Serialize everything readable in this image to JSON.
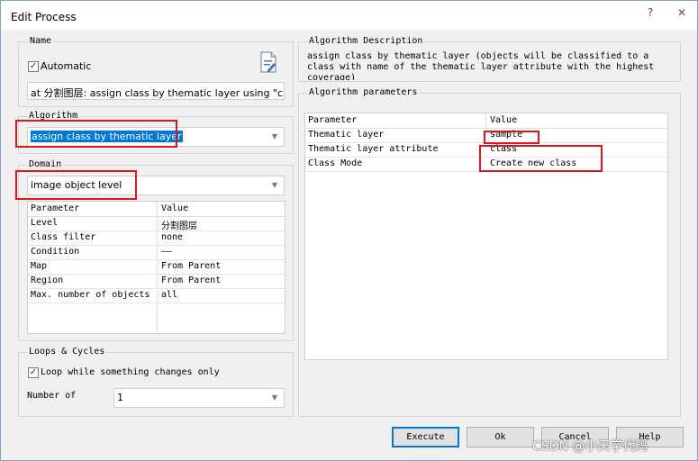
{
  "window": {
    "title": "Edit Process",
    "help_label": "?",
    "close_label": "✕"
  },
  "name_group": {
    "legend": "Name",
    "automatic_label": "Automatic",
    "automatic_checked": true,
    "name_value": "at  分割图层: assign class by thematic layer using \"class\""
  },
  "algorithm_group": {
    "legend": "Algorithm",
    "selected": "assign class by thematic layer"
  },
  "domain_group": {
    "legend": "Domain",
    "selected": "image object level",
    "table": {
      "headers": [
        "Parameter",
        "Value"
      ],
      "rows": [
        [
          "Level",
          "分割图层"
        ],
        [
          "Class filter",
          "none"
        ],
        [
          "Condition",
          "——"
        ],
        [
          "Map",
          "From Parent"
        ],
        [
          "Region",
          "From Parent"
        ],
        [
          "Max. number of objects",
          "all"
        ]
      ]
    }
  },
  "loops_group": {
    "legend": "Loops & Cycles",
    "loop_label": "Loop while something changes only",
    "loop_checked": true,
    "number_of_label": "Number of",
    "number_of_value": "1"
  },
  "description_group": {
    "legend": "Algorithm Description",
    "text": "assign class by thematic layer (objects will be classified to a class with name of the thematic layer attribute with the highest coverage)"
  },
  "params_group": {
    "legend": "Algorithm parameters",
    "table": {
      "headers": [
        "Parameter",
        "Value"
      ],
      "rows": [
        [
          "Thematic layer",
          "sample"
        ],
        [
          "Thematic layer attribute",
          "class"
        ],
        [
          "Class Mode",
          "Create new class"
        ]
      ]
    }
  },
  "buttons": {
    "execute": "Execute",
    "ok": "Ok",
    "cancel": "Cancel",
    "help": "Help"
  },
  "watermark": "CSDN @小天学代码",
  "colors": {
    "highlight_box": "#e0161a",
    "selection": "#0078d7"
  }
}
